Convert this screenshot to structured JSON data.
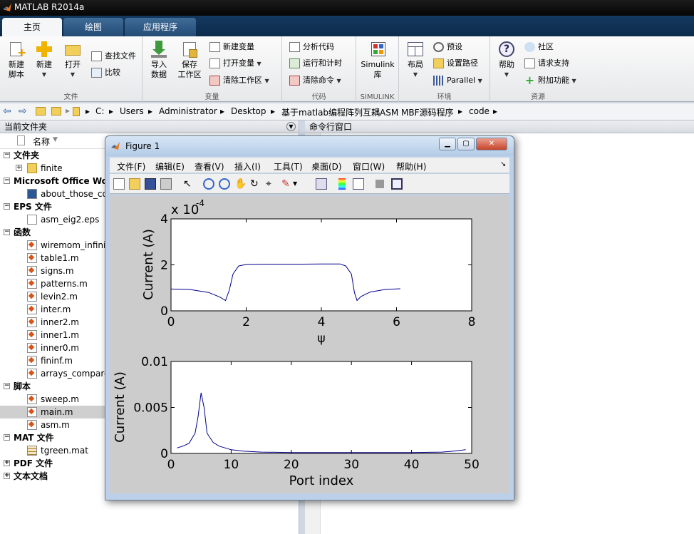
{
  "window": {
    "title": "MATLAB R2014a"
  },
  "tabs": [
    {
      "label": "主页"
    },
    {
      "label": "绘图"
    },
    {
      "label": "应用程序"
    }
  ],
  "ribbon": {
    "file_group": {
      "label": "文件",
      "new_script": "新建\n脚本",
      "new": "新建",
      "open": "打开",
      "find_files": "查找文件",
      "compare": "比较"
    },
    "variable_group": {
      "label": "变量",
      "import": "导入\n数据",
      "save_ws": "保存\n工作区",
      "new_var": "新建变量",
      "open_var": "打开变量",
      "clear_ws": "清除工作区"
    },
    "code_group": {
      "label": "代码",
      "analyze": "分析代码",
      "run_time": "运行和计时",
      "clear_cmd": "清除命令"
    },
    "simulink_group": {
      "label": "SIMULINK",
      "simulink": "Simulink\n库"
    },
    "env_group": {
      "label": "环境",
      "layout": "布局",
      "prefs": "预设",
      "set_path": "设置路径",
      "parallel": "Parallel"
    },
    "resources_group": {
      "label": "资源",
      "help": "帮助",
      "community": "社区",
      "support": "请求支持",
      "addons": "附加功能"
    }
  },
  "address": {
    "segments": [
      "C:",
      "Users",
      "Administrator",
      "Desktop",
      "基于matlab编程阵列互耦ASM MBF源码程序",
      "code"
    ]
  },
  "current_folder": {
    "title": "当前文件夹",
    "col_name": "名称",
    "rows": [
      {
        "kind": "hdr",
        "text": "文件夹",
        "exp": "−"
      },
      {
        "kind": "item",
        "text": "finite",
        "icon": "folder",
        "exp": "+"
      },
      {
        "kind": "hdr",
        "text": "Microsoft Office Wor",
        "exp": "−"
      },
      {
        "kind": "item",
        "text": "about_those_co",
        "icon": "doc"
      },
      {
        "kind": "hdr",
        "text": "EPS 文件",
        "exp": "−"
      },
      {
        "kind": "item",
        "text": "asm_eig2.eps",
        "icon": "file"
      },
      {
        "kind": "hdr",
        "text": "函数",
        "exp": "−"
      },
      {
        "kind": "item",
        "text": "wiremom_infinit",
        "icon": "fx"
      },
      {
        "kind": "item",
        "text": "table1.m",
        "icon": "fx"
      },
      {
        "kind": "item",
        "text": "signs.m",
        "icon": "fx"
      },
      {
        "kind": "item",
        "text": "patterns.m",
        "icon": "fx"
      },
      {
        "kind": "item",
        "text": "levin2.m",
        "icon": "fx"
      },
      {
        "kind": "item",
        "text": "inter.m",
        "icon": "fx"
      },
      {
        "kind": "item",
        "text": "inner2.m",
        "icon": "fx"
      },
      {
        "kind": "item",
        "text": "inner1.m",
        "icon": "fx"
      },
      {
        "kind": "item",
        "text": "inner0.m",
        "icon": "fx"
      },
      {
        "kind": "item",
        "text": "fininf.m",
        "icon": "fx"
      },
      {
        "kind": "item",
        "text": "arrays_compare",
        "icon": "fx"
      },
      {
        "kind": "hdr",
        "text": "脚本",
        "exp": "−"
      },
      {
        "kind": "item",
        "text": "sweep.m",
        "icon": "m"
      },
      {
        "kind": "item",
        "text": "main.m",
        "icon": "m",
        "selected": true
      },
      {
        "kind": "item",
        "text": "asm.m",
        "icon": "m"
      },
      {
        "kind": "hdr",
        "text": "MAT 文件",
        "exp": "−"
      },
      {
        "kind": "item",
        "text": "tgreen.mat",
        "icon": "mat"
      },
      {
        "kind": "hdr",
        "text": "PDF 文件",
        "exp": "+"
      },
      {
        "kind": "hdr",
        "text": "文本文档",
        "exp": "+"
      }
    ]
  },
  "command_window": {
    "title": "命令行窗口"
  },
  "figure": {
    "title": "Figure 1",
    "menu": [
      "文件(F)",
      "编辑(E)",
      "查看(V)",
      "插入(I)",
      "工具(T)",
      "桌面(D)",
      "窗口(W)",
      "帮助(H)"
    ]
  },
  "colors": {
    "line": "#00008b",
    "accent": "#0c2b4b"
  },
  "chart_data": [
    {
      "type": "line",
      "xlabel": "ψ",
      "ylabel": "Current  (A)",
      "exponent_label": "x 10",
      "exponent_power": "-4",
      "xlim": [
        0,
        8
      ],
      "ylim": [
        0,
        4
      ],
      "xticks": [
        "0",
        "2",
        "4",
        "6",
        "8"
      ],
      "yticks": [
        "0",
        "2",
        "4"
      ],
      "series": [
        {
          "x": [
            0,
            0.5,
            1.0,
            1.3,
            1.45,
            1.55,
            1.65,
            1.8,
            2.0,
            2.5,
            3.0,
            3.5,
            4.0,
            4.5,
            4.65,
            4.8,
            4.88,
            4.95,
            5.05,
            5.3,
            5.7,
            6.1
          ],
          "y": [
            0.95,
            0.93,
            0.8,
            0.6,
            0.45,
            0.9,
            1.6,
            1.95,
            2.02,
            2.03,
            2.03,
            2.03,
            2.04,
            2.04,
            1.95,
            1.6,
            0.8,
            0.45,
            0.62,
            0.82,
            0.93,
            0.96
          ]
        }
      ]
    },
    {
      "type": "line",
      "xlabel": "Port index",
      "ylabel": "Current  (A)",
      "xlim": [
        0,
        50
      ],
      "ylim": [
        0,
        0.01
      ],
      "xticks": [
        "0",
        "10",
        "20",
        "30",
        "40",
        "50"
      ],
      "yticks": [
        "0",
        "0.005",
        "0.01"
      ],
      "series": [
        {
          "x": [
            1,
            2,
            3,
            4,
            4.5,
            5,
            5.5,
            6,
            7,
            8,
            10,
            12,
            15,
            20,
            25,
            30,
            35,
            40,
            45,
            47,
            49
          ],
          "y": [
            0.0006,
            0.0008,
            0.0011,
            0.0022,
            0.004,
            0.0066,
            0.005,
            0.0022,
            0.0012,
            0.0008,
            0.0004,
            0.00025,
            0.00015,
            0.0001,
            0.0001,
            0.0001,
            0.0001,
            0.0001,
            0.00015,
            0.00025,
            0.0004
          ]
        }
      ]
    }
  ]
}
